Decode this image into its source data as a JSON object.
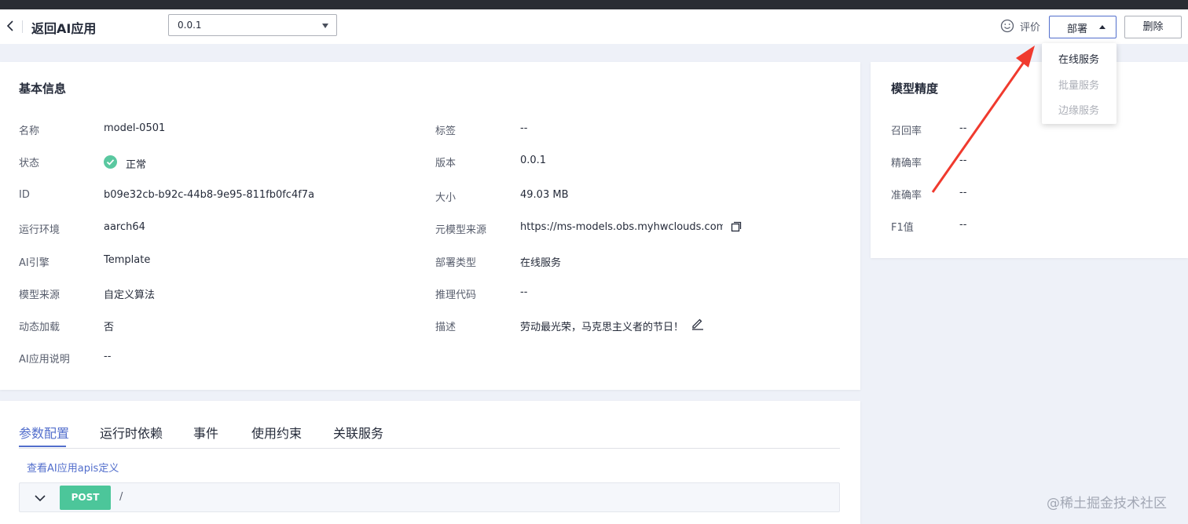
{
  "header": {
    "title": "返回AI应用",
    "version_select": "0.0.1",
    "rate_label": "评价",
    "deploy_label": "部署",
    "delete_label": "删除"
  },
  "deploy_menu": {
    "items": [
      {
        "label": "在线服务",
        "enabled": true
      },
      {
        "label": "批量服务",
        "enabled": false
      },
      {
        "label": "边缘服务",
        "enabled": false
      }
    ]
  },
  "basic_info": {
    "title": "基本信息",
    "left": [
      {
        "label": "名称",
        "value": "model-0501"
      },
      {
        "label": "状态",
        "value": "正常"
      },
      {
        "label": "ID",
        "value": "b09e32cb-b92c-44b8-9e95-811fb0fc4f7a"
      },
      {
        "label": "运行环境",
        "value": "aarch64"
      },
      {
        "label": "AI引擎",
        "value": "Template"
      },
      {
        "label": "模型来源",
        "value": "自定义算法"
      },
      {
        "label": "动态加载",
        "value": "否"
      },
      {
        "label": "AI应用说明",
        "value": "--"
      }
    ],
    "right": [
      {
        "label": "标签",
        "value": "--"
      },
      {
        "label": "版本",
        "value": "0.0.1"
      },
      {
        "label": "大小",
        "value": "49.03 MB"
      },
      {
        "label": "元模型来源",
        "value": "https://ms-models.obs.myhwclouds.com/d..."
      },
      {
        "label": "部署类型",
        "value": "在线服务"
      },
      {
        "label": "推理代码",
        "value": "--"
      },
      {
        "label": "描述",
        "value": "劳动最光荣，马克思主义者的节日！"
      }
    ]
  },
  "accuracy": {
    "title": "模型精度",
    "rows": [
      {
        "label": "召回率",
        "value": "--"
      },
      {
        "label": "精确率",
        "value": "--"
      },
      {
        "label": "准确率",
        "value": "--"
      },
      {
        "label": "F1值",
        "value": "--"
      }
    ]
  },
  "tabs": {
    "items": [
      "参数配置",
      "运行时依赖",
      "事件",
      "使用约束",
      "关联服务"
    ],
    "active": "参数配置"
  },
  "apis": {
    "link": "查看AI应用apis定义",
    "method": "POST",
    "path": "/"
  },
  "watermark": "@稀土掘金技术社区",
  "colors": {
    "accent": "#526ecc",
    "success": "#5ac8a0",
    "post_badge": "#4cc69a",
    "annotation_arrow": "#f03a2e"
  },
  "icons": [
    "back-arrow-icon",
    "chevron-down-icon",
    "smile-icon",
    "caret-up-icon",
    "check-icon",
    "copy-icon",
    "edit-icon"
  ]
}
